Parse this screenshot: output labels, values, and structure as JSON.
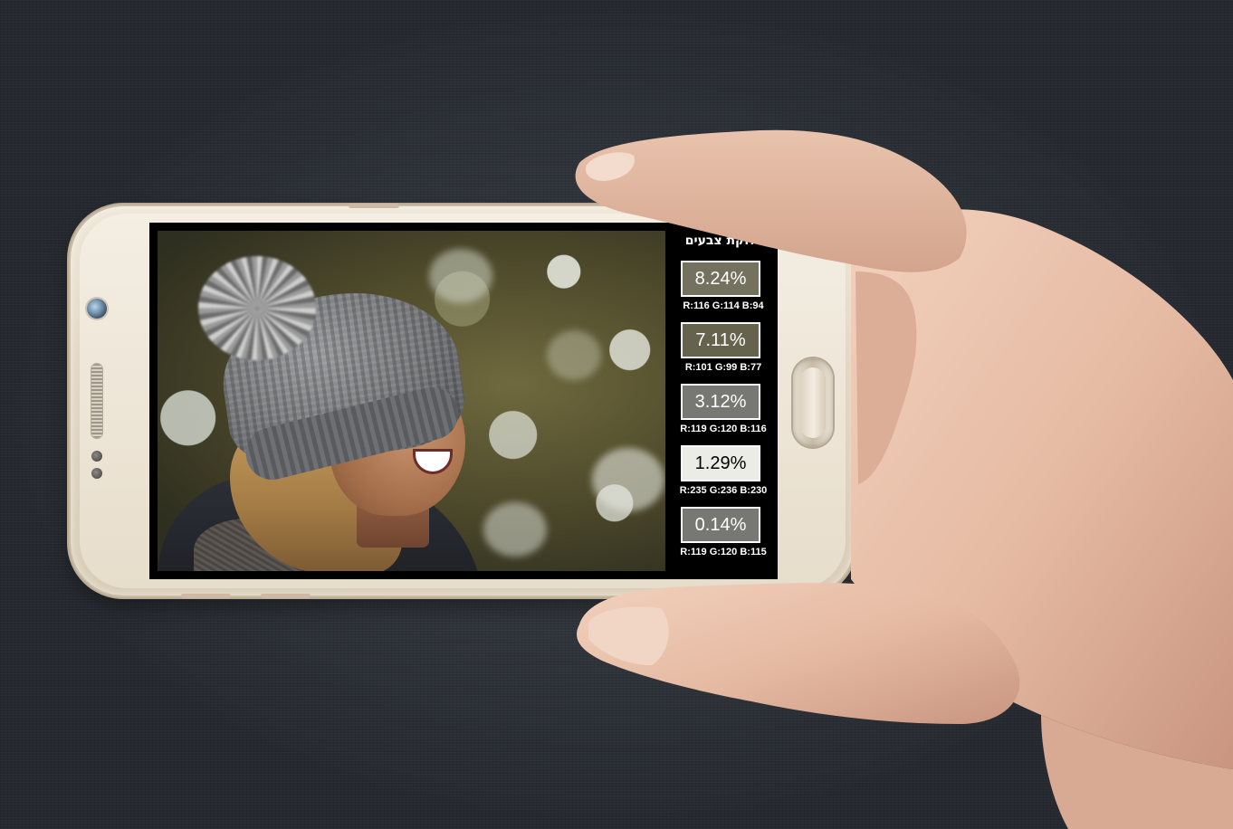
{
  "sidebar": {
    "title": "חלוקת צבעים",
    "swatches": [
      {
        "percent": "8.24%",
        "rgb": "R:116 G:114 B:94",
        "color": "#74725e"
      },
      {
        "percent": "7.11%",
        "rgb": "R:101 G:99 B:77",
        "color": "#65634d"
      },
      {
        "percent": "3.12%",
        "rgb": "R:119 G:120 B:116",
        "color": "#777874"
      },
      {
        "percent": "1.29%",
        "rgb": "R:235 G:236 B:230",
        "color": "#ebece6"
      },
      {
        "percent": "0.14%",
        "rgb": "R:119 G:120 B:115",
        "color": "#777873"
      }
    ]
  },
  "icons": {
    "front_camera": "front-camera-icon",
    "speaker": "speaker-grille-icon",
    "home_button": "home-button-icon"
  }
}
